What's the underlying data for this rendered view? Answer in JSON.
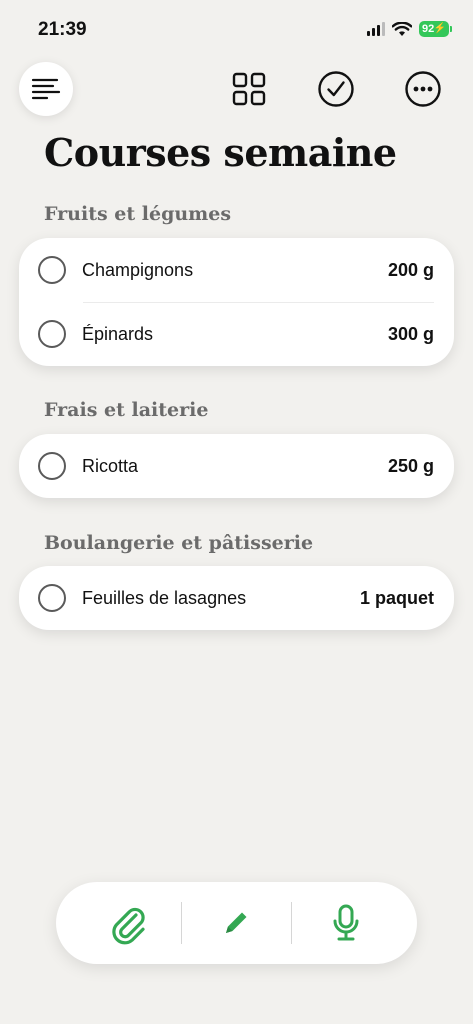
{
  "status_bar": {
    "time": "21:39",
    "battery": "92"
  },
  "toolbar": {
    "icons": [
      "menu-icon",
      "grid-icon",
      "checkmark-circle-icon",
      "more-icon"
    ]
  },
  "page_title": "Courses semaine",
  "sections": [
    {
      "title": "Fruits et légumes",
      "items": [
        {
          "name": "Champignons",
          "qty": "200 g"
        },
        {
          "name": "Épinards",
          "qty": "300 g"
        }
      ]
    },
    {
      "title": "Frais et laiterie",
      "items": [
        {
          "name": "Ricotta",
          "qty": "250 g"
        }
      ]
    },
    {
      "title": "Boulangerie et pâtisserie",
      "items": [
        {
          "name": "Feuilles de lasagnes",
          "qty": "1 paquet"
        }
      ]
    }
  ],
  "bottom_bar": {
    "icons": [
      "paperclip-icon",
      "pencil-icon",
      "microphone-icon"
    ]
  },
  "colors": {
    "background": "#f2f1ee",
    "accent_green": "#34a853",
    "battery_green": "#34c759",
    "section_heading": "#6b6b6b"
  }
}
